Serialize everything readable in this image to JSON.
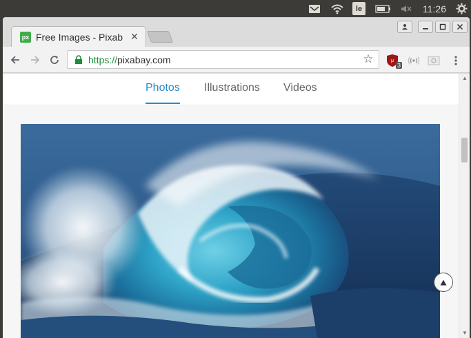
{
  "system_panel": {
    "keyboard_layout": "le",
    "clock": "11:26"
  },
  "browser": {
    "tab": {
      "favicon_text": "px",
      "title": "Free Images - Pixab"
    },
    "address_bar": {
      "scheme": "https://",
      "host": "pixabay.com"
    },
    "extension_badge": "3"
  },
  "page": {
    "nav_tabs": [
      {
        "label": "Photos",
        "active": true
      },
      {
        "label": "Illustrations",
        "active": false
      },
      {
        "label": "Videos",
        "active": false
      }
    ]
  },
  "colors": {
    "accent": "#2a8ac8",
    "secure_green": "#1e8e3e",
    "pixabay_green": "#3fae49"
  }
}
